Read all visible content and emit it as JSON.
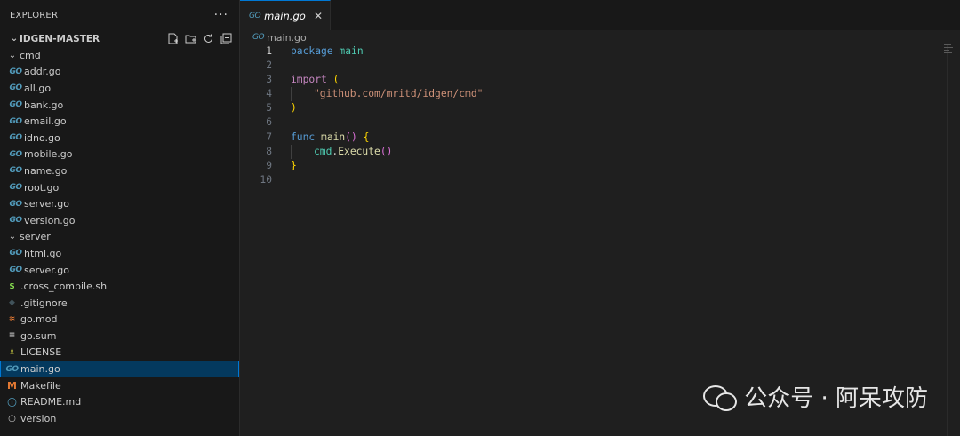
{
  "explorer": {
    "title": "EXPLORER",
    "more": "···",
    "section": "IDGEN-MASTER",
    "items": [
      {
        "label": "cmd",
        "type": "folder",
        "depth": 0
      },
      {
        "label": "addr.go",
        "type": "go",
        "depth": 1
      },
      {
        "label": "all.go",
        "type": "go",
        "depth": 1
      },
      {
        "label": "bank.go",
        "type": "go",
        "depth": 1
      },
      {
        "label": "email.go",
        "type": "go",
        "depth": 1
      },
      {
        "label": "idno.go",
        "type": "go",
        "depth": 1
      },
      {
        "label": "mobile.go",
        "type": "go",
        "depth": 1
      },
      {
        "label": "name.go",
        "type": "go",
        "depth": 1
      },
      {
        "label": "root.go",
        "type": "go",
        "depth": 1
      },
      {
        "label": "server.go",
        "type": "go",
        "depth": 1
      },
      {
        "label": "version.go",
        "type": "go",
        "depth": 1
      },
      {
        "label": "server",
        "type": "folder",
        "depth": 0
      },
      {
        "label": "html.go",
        "type": "go",
        "depth": 1
      },
      {
        "label": "server.go",
        "type": "go",
        "depth": 1
      },
      {
        "label": ".cross_compile.sh",
        "type": "sh",
        "depth": 0
      },
      {
        "label": ".gitignore",
        "type": "git",
        "depth": 0
      },
      {
        "label": "go.mod",
        "type": "mod",
        "depth": 0
      },
      {
        "label": "go.sum",
        "type": "sum",
        "depth": 0
      },
      {
        "label": "LICENSE",
        "type": "license",
        "depth": 0
      },
      {
        "label": "main.go",
        "type": "go",
        "depth": 0,
        "selected": true
      },
      {
        "label": "Makefile",
        "type": "make",
        "depth": 0
      },
      {
        "label": "README.md",
        "type": "readme",
        "depth": 0
      },
      {
        "label": "version",
        "type": "version",
        "depth": 0
      }
    ]
  },
  "editor": {
    "tab_label": "main.go",
    "breadcrumb": "main.go",
    "line_numbers": [
      "1",
      "2",
      "3",
      "4",
      "5",
      "6",
      "7",
      "8",
      "9",
      "10"
    ]
  },
  "code": {
    "l1_kw": "package",
    "l1_name": "main",
    "l3_kw": "import",
    "l3_paren": "(",
    "l4_str": "\"github.com/mritd/idgen/cmd\"",
    "l5_paren": ")",
    "l7_kw": "func",
    "l7_fn": "main",
    "l7_parens": "()",
    "l7_brace": "{",
    "l8_pkg": "cmd",
    "l8_dot": ".",
    "l8_fn": "Execute",
    "l8_parens": "()",
    "l9_brace": "}"
  },
  "icons": {
    "go": "GO",
    "sh": "$",
    "git": "◆",
    "mod": "≋",
    "sum": "≡",
    "license": "♗",
    "make": "M",
    "readme": "ⓘ",
    "version": "○"
  },
  "watermark": {
    "text": "公众号 · 阿呆攻防"
  },
  "colors": {
    "selection": "#04395e",
    "accent": "#0078d4",
    "go_icon": "#519aba"
  }
}
